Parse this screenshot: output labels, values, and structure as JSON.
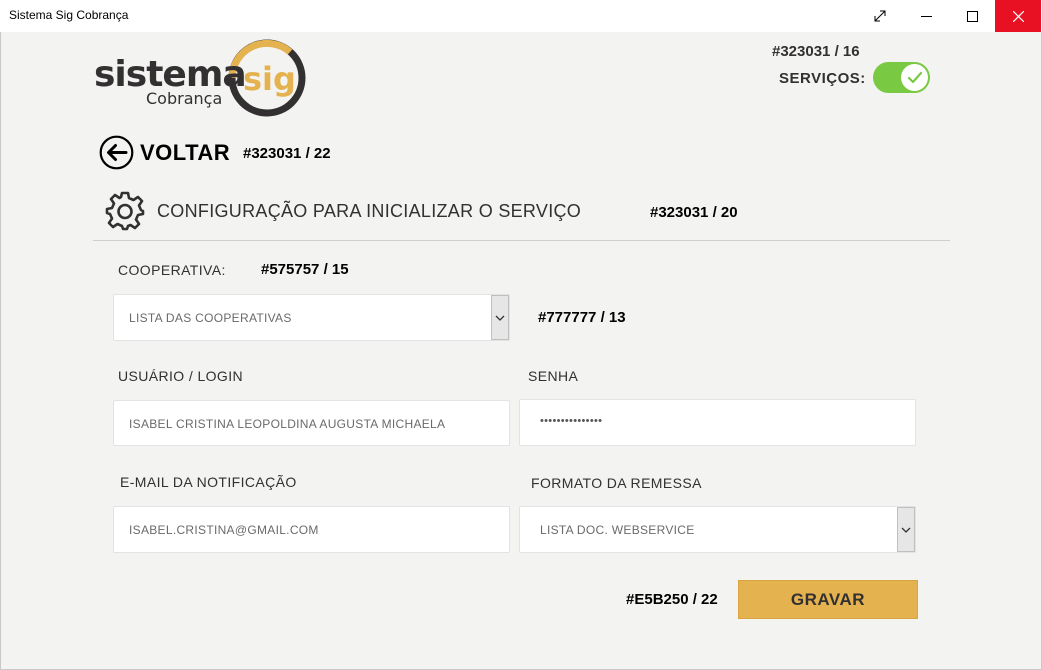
{
  "window": {
    "title": "Sistema Sig Cobrança"
  },
  "logo": {
    "text_main": "sistema",
    "text_badge": "sig",
    "text_sub": "Cobrança"
  },
  "header": {
    "color_note": "#323031 / 16",
    "services_label": "SERVIÇOS:",
    "services_enabled": true
  },
  "nav": {
    "back_label": "VOLTAR",
    "back_note": "#323031 / 22"
  },
  "section": {
    "title": "CONFIGURAÇÃO PARA INICIALIZAR O SERVIÇO",
    "title_note": "#323031 / 20"
  },
  "form": {
    "cooperativa": {
      "label": "COOPERATIVA:",
      "label_note": "#575757 / 15",
      "value": "LISTA DAS COOPERATIVAS",
      "value_note": "#777777 / 13"
    },
    "usuario": {
      "label": "USUÁRIO / LOGIN",
      "value": "ISABEL CRISTINA LEOPOLDINA AUGUSTA MICHAELA"
    },
    "senha": {
      "label": "SENHA",
      "value": "•••••••••••••••"
    },
    "email": {
      "label": "E-MAIL DA NOTIFICAÇÃO",
      "value": "ISABEL.CRISTINA@GMAIL.COM"
    },
    "formato": {
      "label": "FORMATO DA REMESSA",
      "value": "LISTA DOC. WEBSERVICE"
    }
  },
  "actions": {
    "save_label": "GRAVAR",
    "save_note": "#E5B250 / 22"
  },
  "colors": {
    "accent": "#e5b250",
    "text": "#323031",
    "toggle_on": "#7ac943",
    "close": "#e81123"
  }
}
